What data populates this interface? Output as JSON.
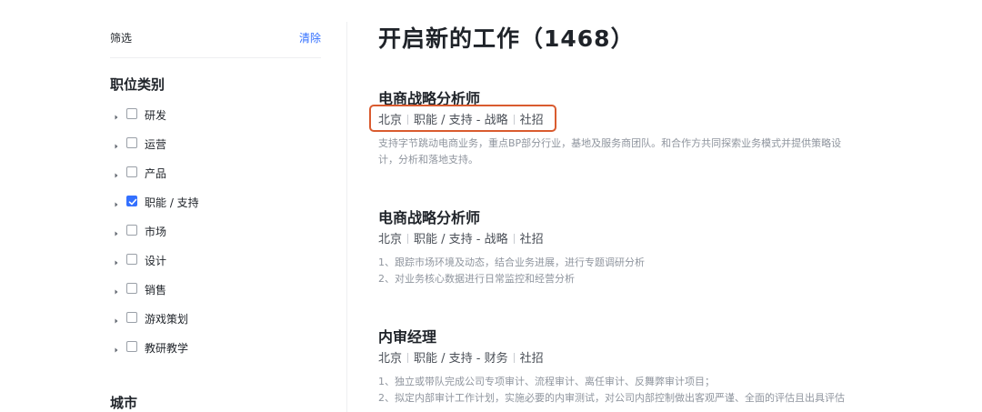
{
  "sidebar": {
    "filter_title": "筛选",
    "clear_label": "清除",
    "category_title": "职位类别",
    "categories": [
      {
        "label": "研发",
        "checked": false
      },
      {
        "label": "运营",
        "checked": false
      },
      {
        "label": "产品",
        "checked": false
      },
      {
        "label": "职能 / 支持",
        "checked": true
      },
      {
        "label": "市场",
        "checked": false
      },
      {
        "label": "设计",
        "checked": false
      },
      {
        "label": "销售",
        "checked": false
      },
      {
        "label": "游戏策划",
        "checked": false
      },
      {
        "label": "教研教学",
        "checked": false
      }
    ],
    "city_title": "城市"
  },
  "main": {
    "page_title": "开启新的工作（1468）",
    "jobs": [
      {
        "title": "电商战略分析师",
        "tags": [
          "北京",
          "职能 / 支持 - 战略",
          "社招"
        ],
        "desc": [
          "支持字节跳动电商业务，重点BP部分行业，基地及服务商团队。和合作方共同探索业务模式并提供策略设",
          "计，分析和落地支持。"
        ]
      },
      {
        "title": "电商战略分析师",
        "tags": [
          "北京",
          "职能 / 支持 - 战略",
          "社招"
        ],
        "desc": [
          "1、跟踪市场环境及动态，结合业务进展，进行专题调研分析",
          "2、对业务核心数据进行日常监控和经营分析"
        ]
      },
      {
        "title": "内审经理",
        "tags": [
          "北京",
          "职能 / 支持 - 财务",
          "社招"
        ],
        "desc": [
          "1、独立或带队完成公司专项审计、流程审计、离任审计、反舞弊审计项目；",
          "2、拟定内部审计工作计划，实施必要的内审测试，对公司内部控制做出客观严谨、全面的评估且出具评估"
        ]
      }
    ]
  },
  "colors": {
    "accent": "#3370ff",
    "highlight": "#d95b2f",
    "muted_text": "#8f959e"
  }
}
